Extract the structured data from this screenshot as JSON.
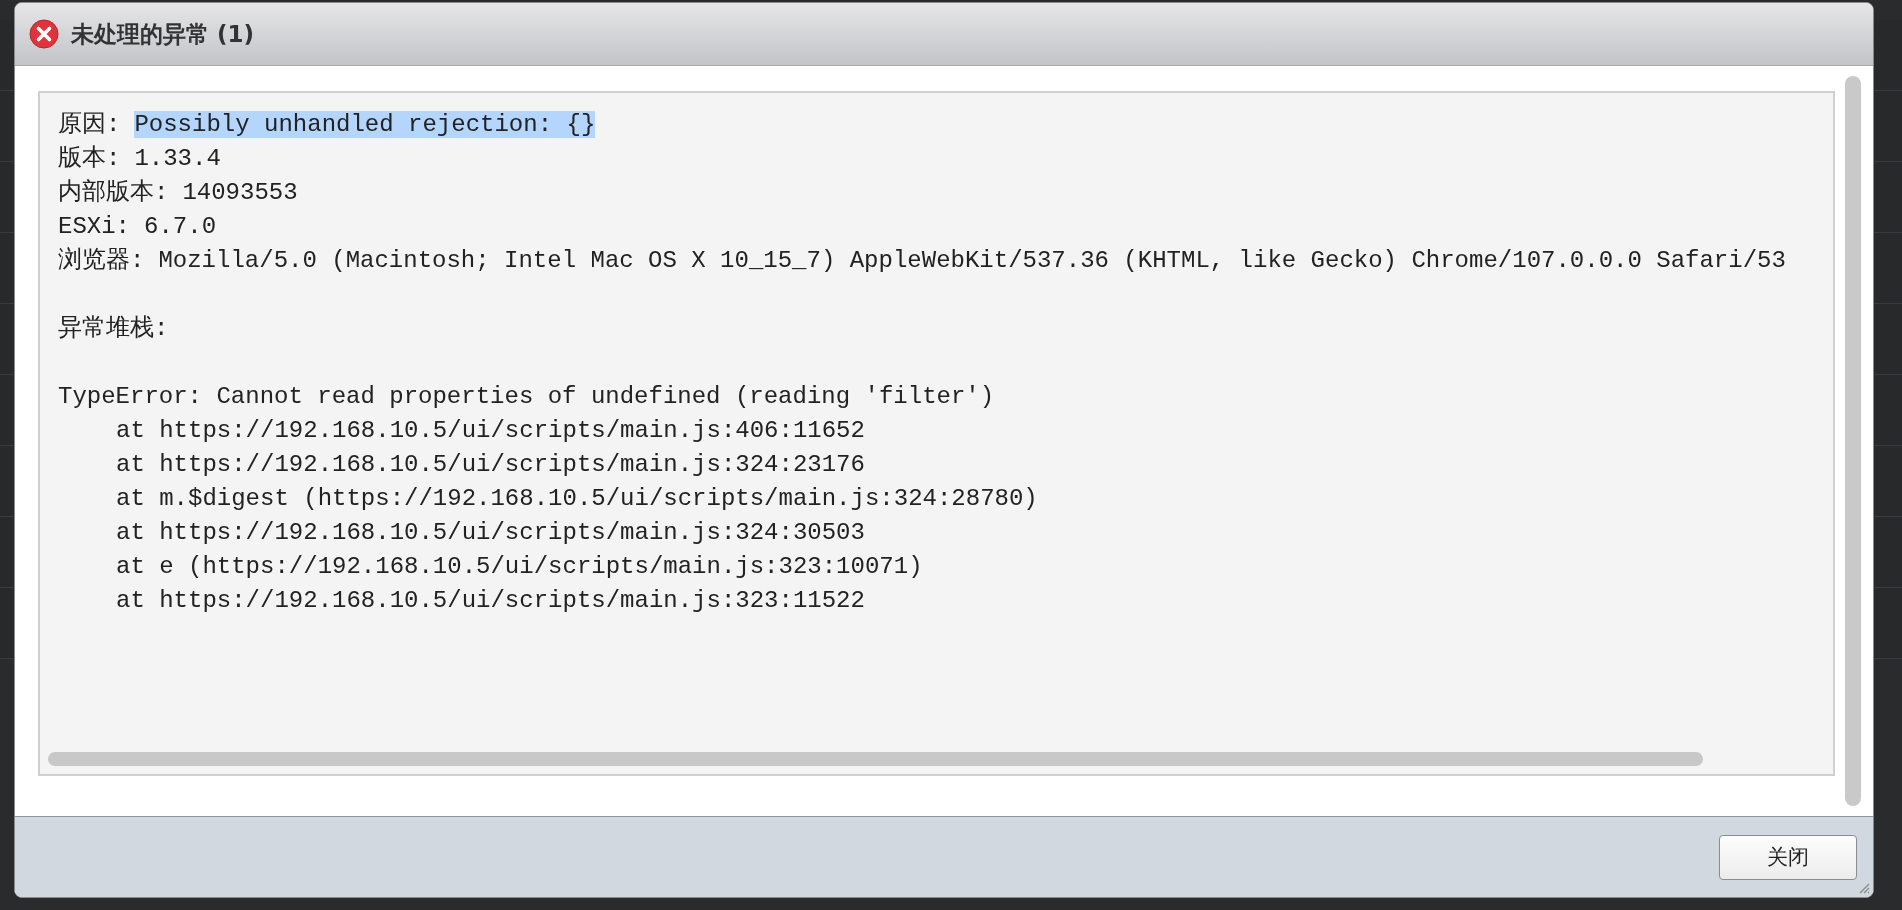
{
  "dialog": {
    "title": "未处理的异常 (1)",
    "fields": [
      {
        "label": "原因:",
        "value": "Possibly unhandled rejection: {}",
        "highlighted": true
      },
      {
        "label": "版本:",
        "value": "1.33.4",
        "highlighted": false
      },
      {
        "label": "内部版本:",
        "value": "14093553",
        "highlighted": false
      },
      {
        "label": "ESXi:",
        "value": "6.7.0",
        "highlighted": false
      },
      {
        "label": "浏览器:",
        "value": "Mozilla/5.0 (Macintosh; Intel Mac OS X 10_15_7) AppleWebKit/537.36 (KHTML, like Gecko) Chrome/107.0.0.0 Safari/53",
        "highlighted": false
      }
    ],
    "stack_heading": "异常堆栈:",
    "error": "TypeError: Cannot read properties of undefined (reading 'filter')",
    "frames": [
      "at https://192.168.10.5/ui/scripts/main.js:406:11652",
      "at https://192.168.10.5/ui/scripts/main.js:324:23176",
      "at m.$digest (https://192.168.10.5/ui/scripts/main.js:324:28780)",
      "at https://192.168.10.5/ui/scripts/main.js:324:30503",
      "at e (https://192.168.10.5/ui/scripts/main.js:323:10071)",
      "at https://192.168.10.5/ui/scripts/main.js:323:11522"
    ],
    "buttons": [
      "关闭"
    ]
  }
}
